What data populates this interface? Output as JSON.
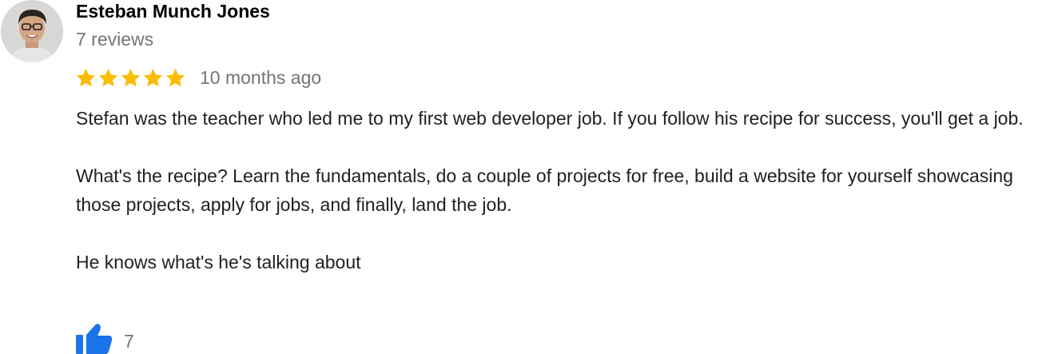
{
  "review": {
    "author_name": "Esteban Munch Jones",
    "author_review_count": "7 reviews",
    "rating": 5,
    "rating_max": 5,
    "date": "10 months ago",
    "paragraphs": [
      "Stefan was the teacher who led me to my first web developer job. If you follow his recipe for success, you'll get a job.",
      "What's the recipe? Learn the fundamentals, do a couple of projects for free, build a website for yourself showcasing those projects, apply for jobs, and finally, land the job.",
      "He knows what's he's talking about"
    ],
    "like_count": "7"
  },
  "icons": {
    "star": "star-icon",
    "like": "thumbs-up-icon",
    "avatar": "avatar-photo"
  },
  "colors": {
    "star": "#fbbc04",
    "like": "#1a73e8",
    "secondary_text": "#70757a"
  }
}
